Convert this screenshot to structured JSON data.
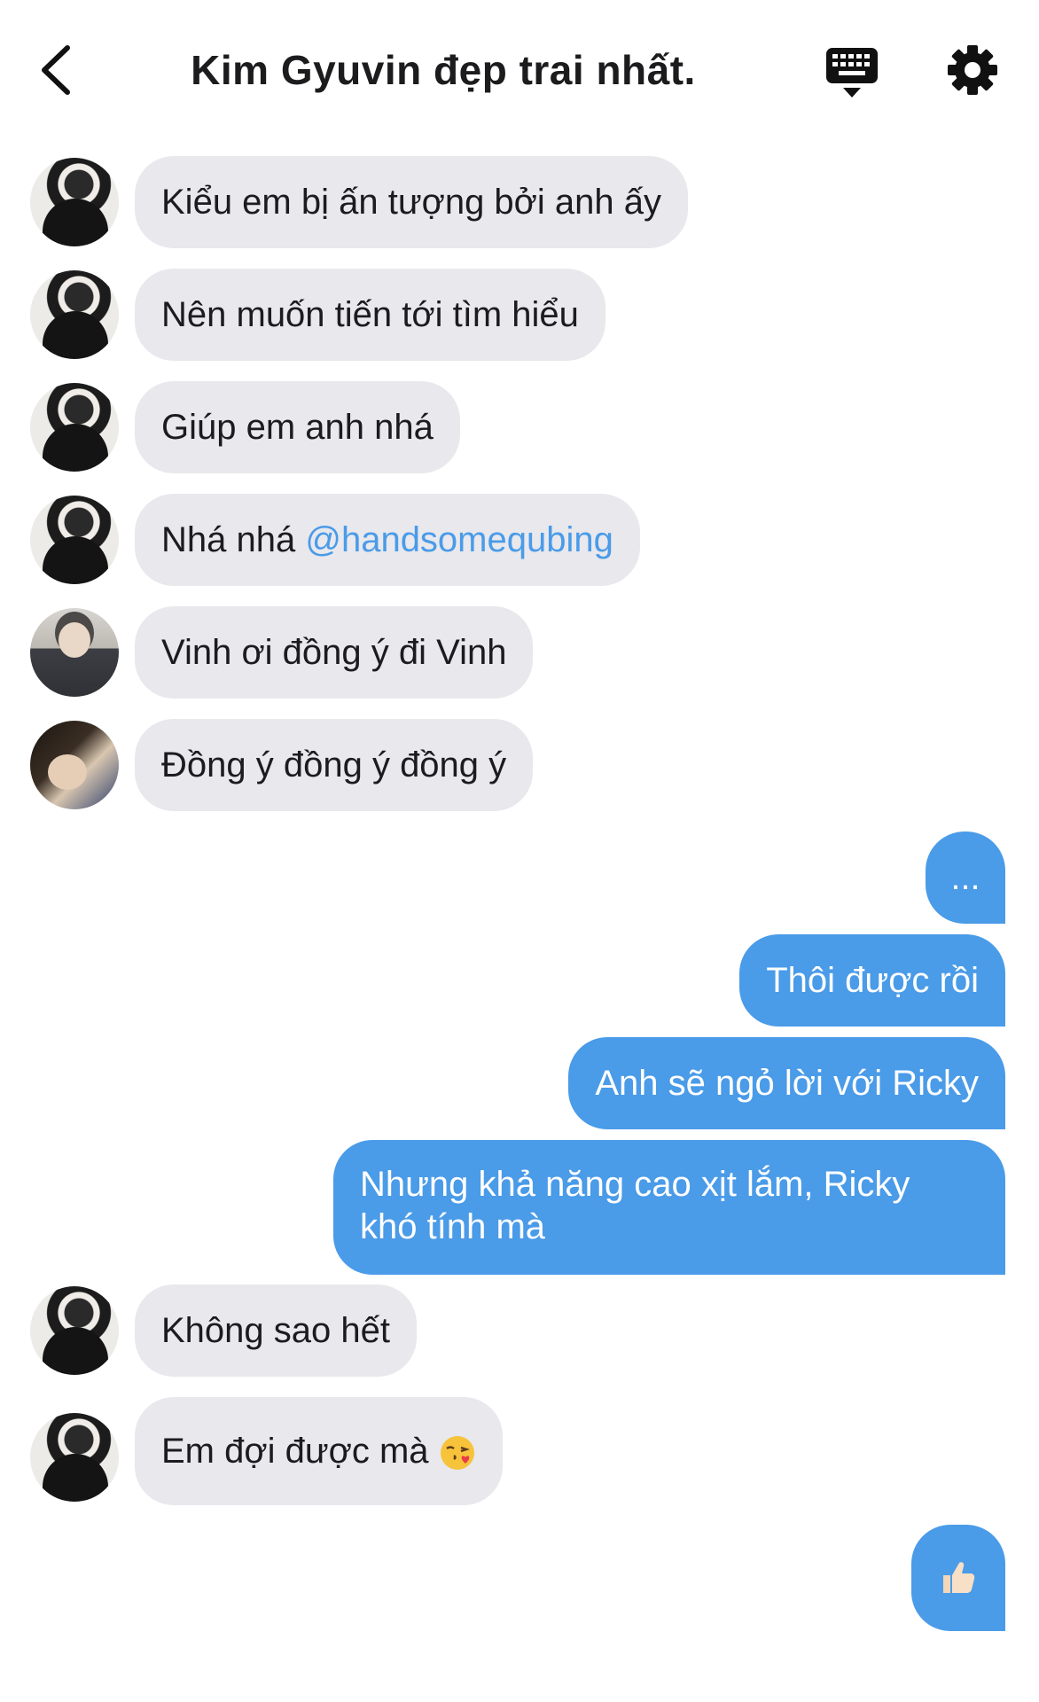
{
  "header": {
    "title": "Kim Gyuvin đẹp trai nhất."
  },
  "messages": {
    "m1": "Kiểu em bị ấn tượng bởi anh ấy",
    "m2": "Nên muốn tiến tới tìm hiểu",
    "m3": "Giúp em anh nhá",
    "m4_text": "Nhá nhá ",
    "m4_mention": "@handsomequbing",
    "m5": "Vinh ơi đồng ý đi Vinh",
    "m6": "Đồng ý đồng ý đồng ý",
    "m7": "...",
    "m8": "Thôi được rồi",
    "m9": "Anh sẽ ngỏ lời với Ricky",
    "m10_line1": "Nhưng khả năng cao xịt lắm, Ricky",
    "m10_line2": "khó tính mà",
    "m11": "Không sao hết",
    "m12": "Em đợi được mà"
  },
  "colors": {
    "outgoing_bubble": "#4a9be8",
    "incoming_bubble": "#e8e8ed",
    "mention": "#4a9be8"
  },
  "icons": {
    "back": "chevron-left-icon",
    "keyboard": "keyboard-icon",
    "settings": "gear-icon",
    "kiss_emoji": "face-blowing-kiss-icon",
    "like": "thumbs-up-icon"
  }
}
